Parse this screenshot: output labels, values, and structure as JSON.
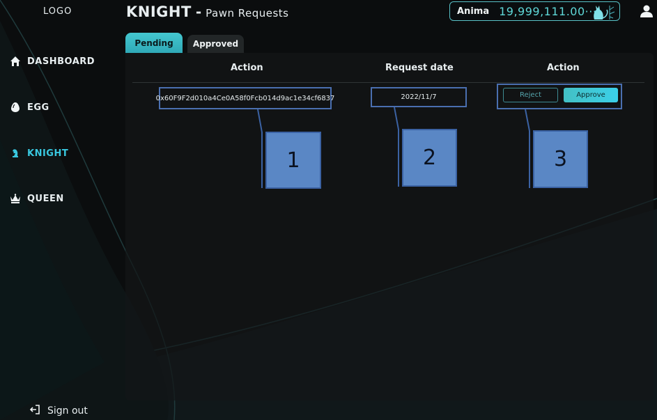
{
  "sidebar": {
    "logo": "LOGO",
    "items": [
      {
        "label": "DASHBOARD",
        "icon": "home-icon"
      },
      {
        "label": "EGG",
        "icon": "egg-icon"
      },
      {
        "label": "KNIGHT",
        "icon": "knight-icon",
        "active": true
      },
      {
        "label": "QUEEN",
        "icon": "crown-icon"
      }
    ],
    "sign_out": "Sign out"
  },
  "header": {
    "title": "KNIGHT",
    "separator": "-",
    "subtitle": "Pawn Requests"
  },
  "balance": {
    "label": "Anima",
    "value": "19,999,111.00···",
    "icon": "cat-mascot-icon"
  },
  "tabs": [
    {
      "label": "Pending",
      "active": true
    },
    {
      "label": "Approved",
      "active": false
    }
  ],
  "table": {
    "columns": [
      "Action",
      "Request date",
      "Action"
    ],
    "rows": [
      {
        "address": "0x60F9F2d010a4Ce0A58f0Fcb014d9ac1e34cf6837",
        "date": "2022/11/7",
        "reject_label": "Reject",
        "approve_label": "Approve"
      }
    ]
  },
  "annotations": [
    "1",
    "2",
    "3"
  ],
  "colors": {
    "accent": "#39c8e0",
    "annotation_box": "#5a87c5",
    "annotation_border": "#4a6fb0"
  }
}
